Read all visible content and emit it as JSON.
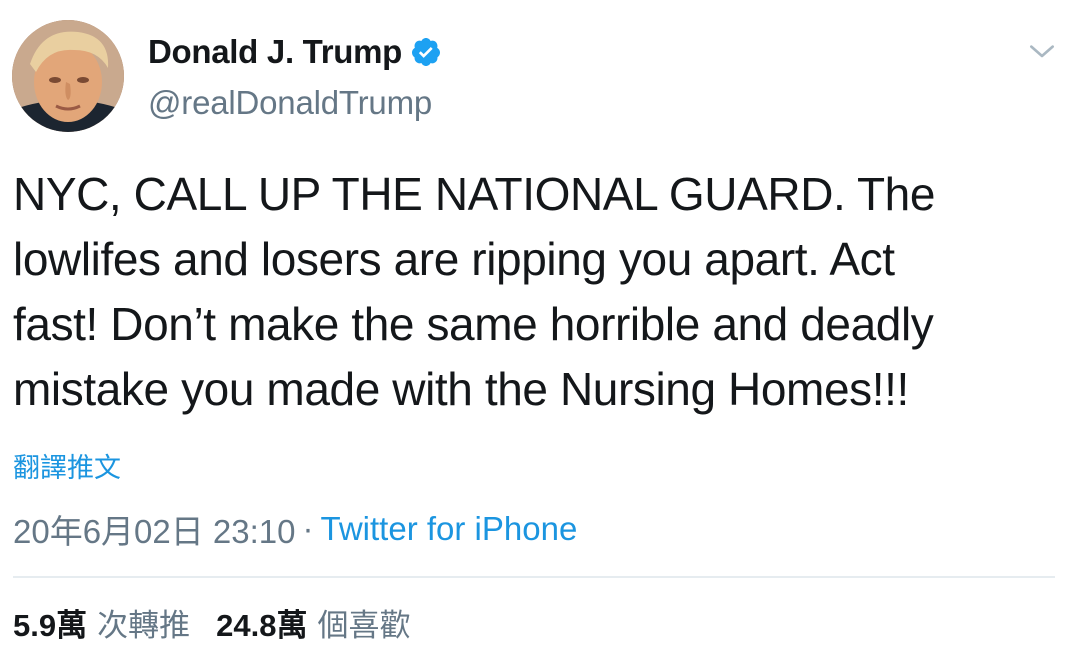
{
  "author": {
    "display_name": "Donald J. Trump",
    "handle": "@realDonaldTrump",
    "verified": true,
    "avatar_icon": "profile-photo"
  },
  "tweet": {
    "lines": [
      "NYC, CALL UP THE NATIONAL GUARD. The",
      "lowlifes and losers are ripping you apart. Act",
      "fast! Don’t make the same horrible and deadly",
      "mistake you made with the Nursing Homes!!!"
    ],
    "translate_label": "翻譯推文",
    "timestamp": "20年6月02日 23:10",
    "separator": "·",
    "source": "Twitter for iPhone"
  },
  "stats": {
    "retweets_count": "5.9萬",
    "retweets_label": "次轉推",
    "likes_count": "24.8萬",
    "likes_label": "個喜歡"
  },
  "colors": {
    "link": "#1b95e0",
    "muted": "#657786",
    "text": "#14171a",
    "verified_badge": "#1da1f2"
  },
  "icons": {
    "verified": "verified-badge-icon",
    "menu": "chevron-down-icon"
  }
}
